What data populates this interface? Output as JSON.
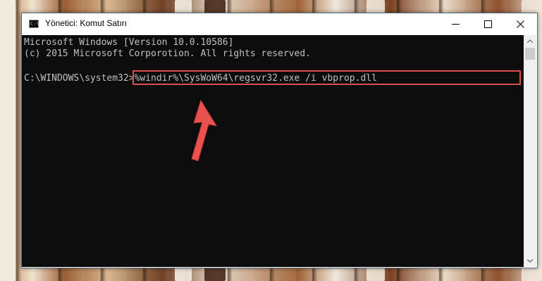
{
  "window": {
    "title": "Yönetici: Komut Satırı",
    "icon": "cmd-icon"
  },
  "console": {
    "line1": "Microsoft Windows [Version 10.0.10586]",
    "line2": "(c) 2015 Microsoft Corporotion. All rights reserved.",
    "prompt": "C:\\WINDOWS\\system32>",
    "command": "%windir%\\SysWoW64\\regsvr32.exe /i vbprop.dll"
  },
  "colors": {
    "console_bg": "#0c0c0c",
    "console_text": "#c0c0c0",
    "highlight": "#e24b4b",
    "arrow": "#e8514d"
  }
}
